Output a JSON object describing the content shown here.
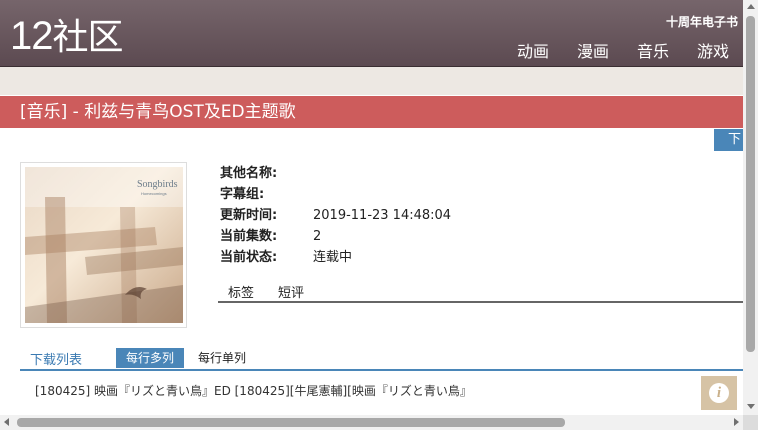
{
  "header": {
    "logo_num": "12",
    "logo_text": "社区",
    "promo": "十周年电子书",
    "nav": [
      "动画",
      "漫画",
      "音乐",
      "游戏"
    ]
  },
  "page": {
    "title": "[音乐] - 利兹与青鸟OST及ED主题歌",
    "download_button": "下载"
  },
  "cover": {
    "title_text": "Songbirds",
    "subtitle_text": "Homecomings"
  },
  "info": {
    "rows": [
      {
        "key": "其他名称:",
        "value": ""
      },
      {
        "key": "字幕组:",
        "value": ""
      },
      {
        "key": "更新时间:",
        "value": "2019-11-23 14:48:04"
      },
      {
        "key": "当前集数:",
        "value": "2"
      },
      {
        "key": "当前状态:",
        "value": "连载中"
      }
    ]
  },
  "tabs": [
    "标签",
    "短评"
  ],
  "download_list": {
    "title": "下载列表",
    "mode_multi": "每行多列",
    "mode_single": "每行单列",
    "entry": "[180425] 映画『リズと青い鳥』ED [180425][牛尾憲輔][映画『リズと青い鳥』オリジナルサウンドトラック"
  },
  "colors": {
    "header": "#6b5a60",
    "title_bar": "#cd5c5c",
    "accent_blue": "#4a86b8",
    "info_button": "#d6c3a5"
  },
  "icons": {
    "info": "info-icon"
  },
  "info_button_glyph": "i"
}
